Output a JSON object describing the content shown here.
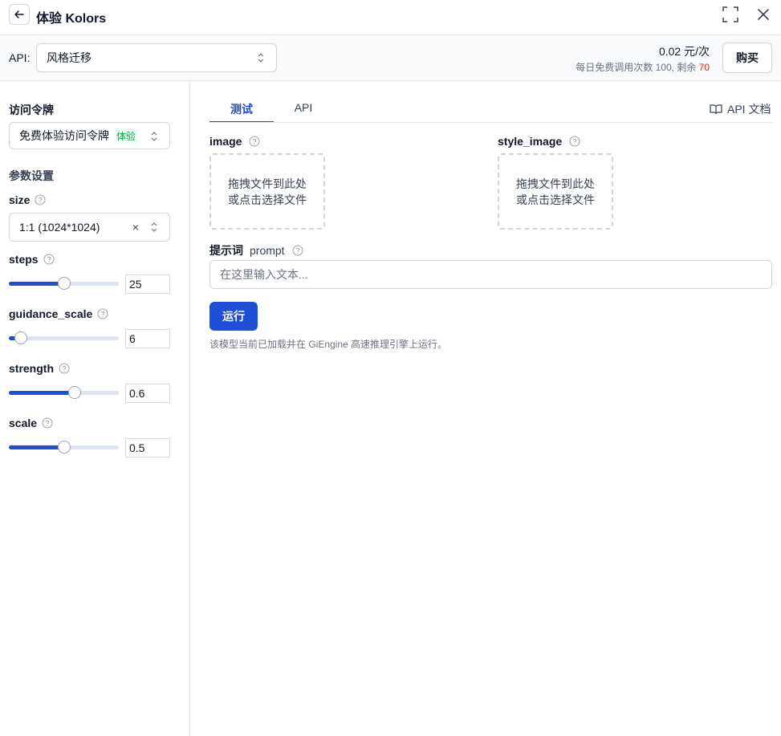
{
  "titlebar": {
    "title": "体验  Kolors",
    "back_icon": "arrow-left-icon",
    "fullscreen_icon": "fullscreen-icon",
    "close_icon": "close-icon"
  },
  "apibar": {
    "label": "API:",
    "selected_api": "风格迁移",
    "price": "0.02 元/次",
    "quota_text": "每日免费调用次数 100, 剩余 ",
    "quota_remaining": "70",
    "buy_label": "购买"
  },
  "sidebar": {
    "token_label": "访问令牌",
    "token_value": "免费体验访问令牌",
    "token_badge": "体验",
    "params_label": "参数设置",
    "size_label": "size",
    "size_value": "1:1 (1024*1024)",
    "clear_symbol": "×",
    "params": [
      {
        "label": "steps",
        "value": "25",
        "fraction": 0.5
      },
      {
        "label": "guidance_scale",
        "value": "6",
        "fraction": 0.11
      },
      {
        "label": "strength",
        "value": "0.6",
        "fraction": 0.6
      },
      {
        "label": "scale",
        "value": "0.5",
        "fraction": 0.5
      }
    ]
  },
  "main": {
    "tabs": [
      {
        "label": "测试",
        "active": true
      },
      {
        "label": "API",
        "active": false
      }
    ],
    "api_doc_label": "API 文档",
    "image_label": "image",
    "style_image_label": "style_image",
    "dropzone_line1": "拖拽文件到此处",
    "dropzone_line2": "或点击选择文件",
    "prompt_label": "提示词",
    "prompt_sub": "prompt",
    "prompt_placeholder": "在这里输入文本...",
    "run_label": "运行",
    "engine_note": "该模型当前已加载并在 GiEngine 高速推理引擎上运行。"
  },
  "colors": {
    "accent": "#1d4ed8",
    "badge_green": "#16a34a",
    "remain_red": "#dc2626"
  }
}
